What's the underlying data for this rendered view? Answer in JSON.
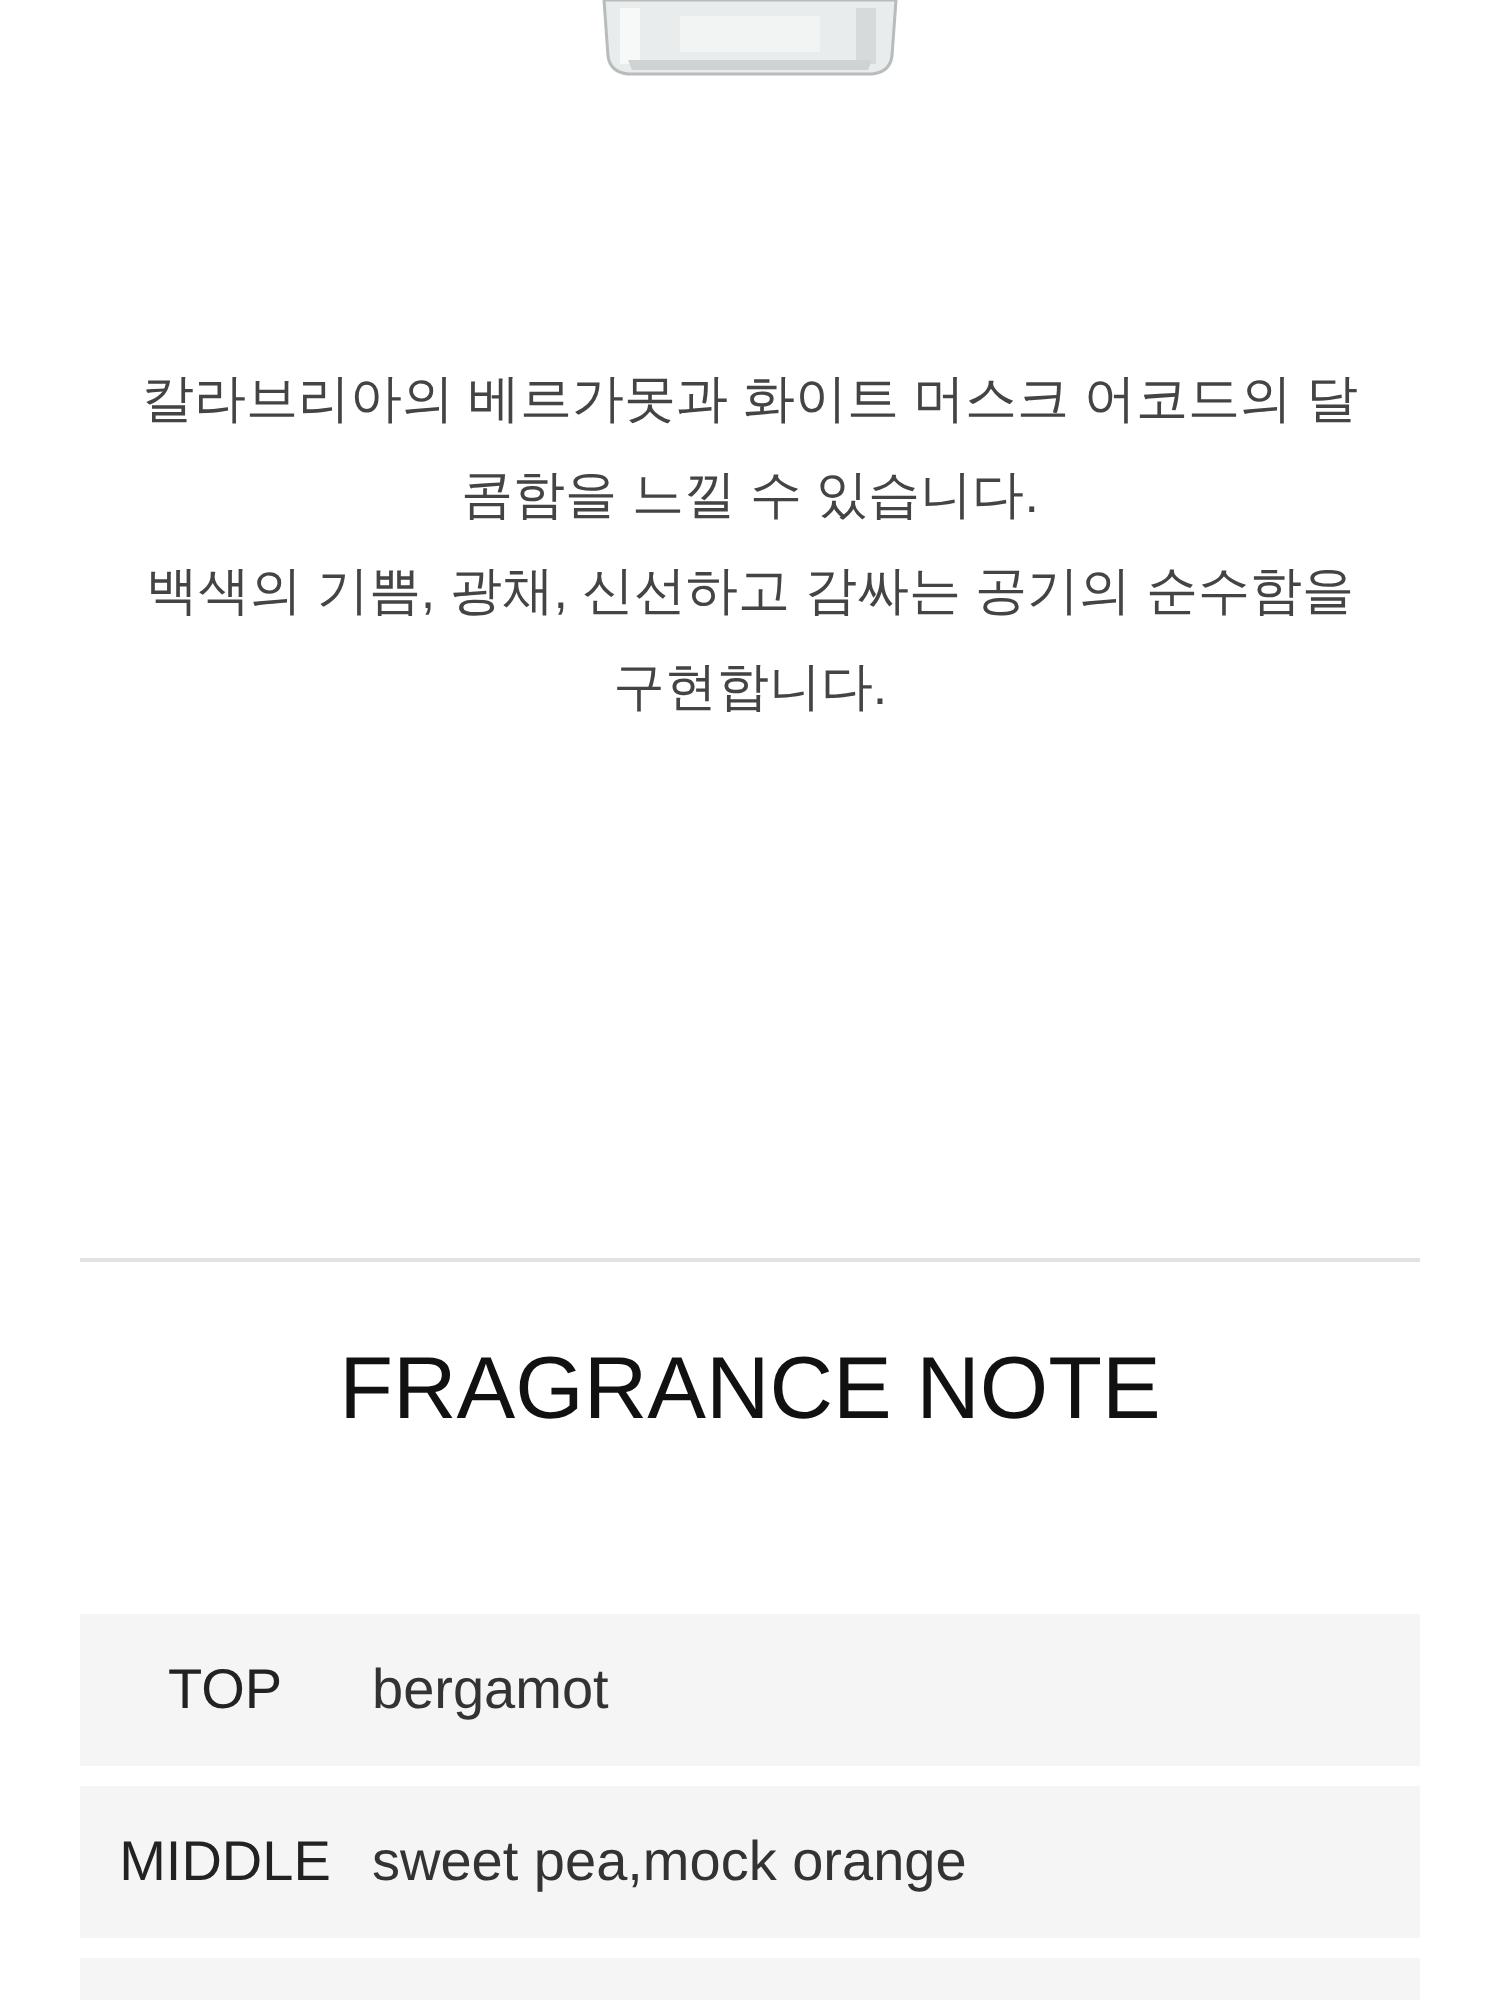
{
  "description": [
    "칼라브리아의 베르가못과 화이트 머스크 어코드의 달콤함을 느낄 수 있습니다.",
    "백색의 기쁨, 광채, 신선하고 감싸는 공기의 순수함을 구현합니다."
  ],
  "section_title": "FRAGRANCE NOTE",
  "notes": [
    {
      "label": "TOP",
      "value": "bergamot"
    },
    {
      "label": "MIDDLE",
      "value": "sweet pea,mock orange"
    }
  ]
}
